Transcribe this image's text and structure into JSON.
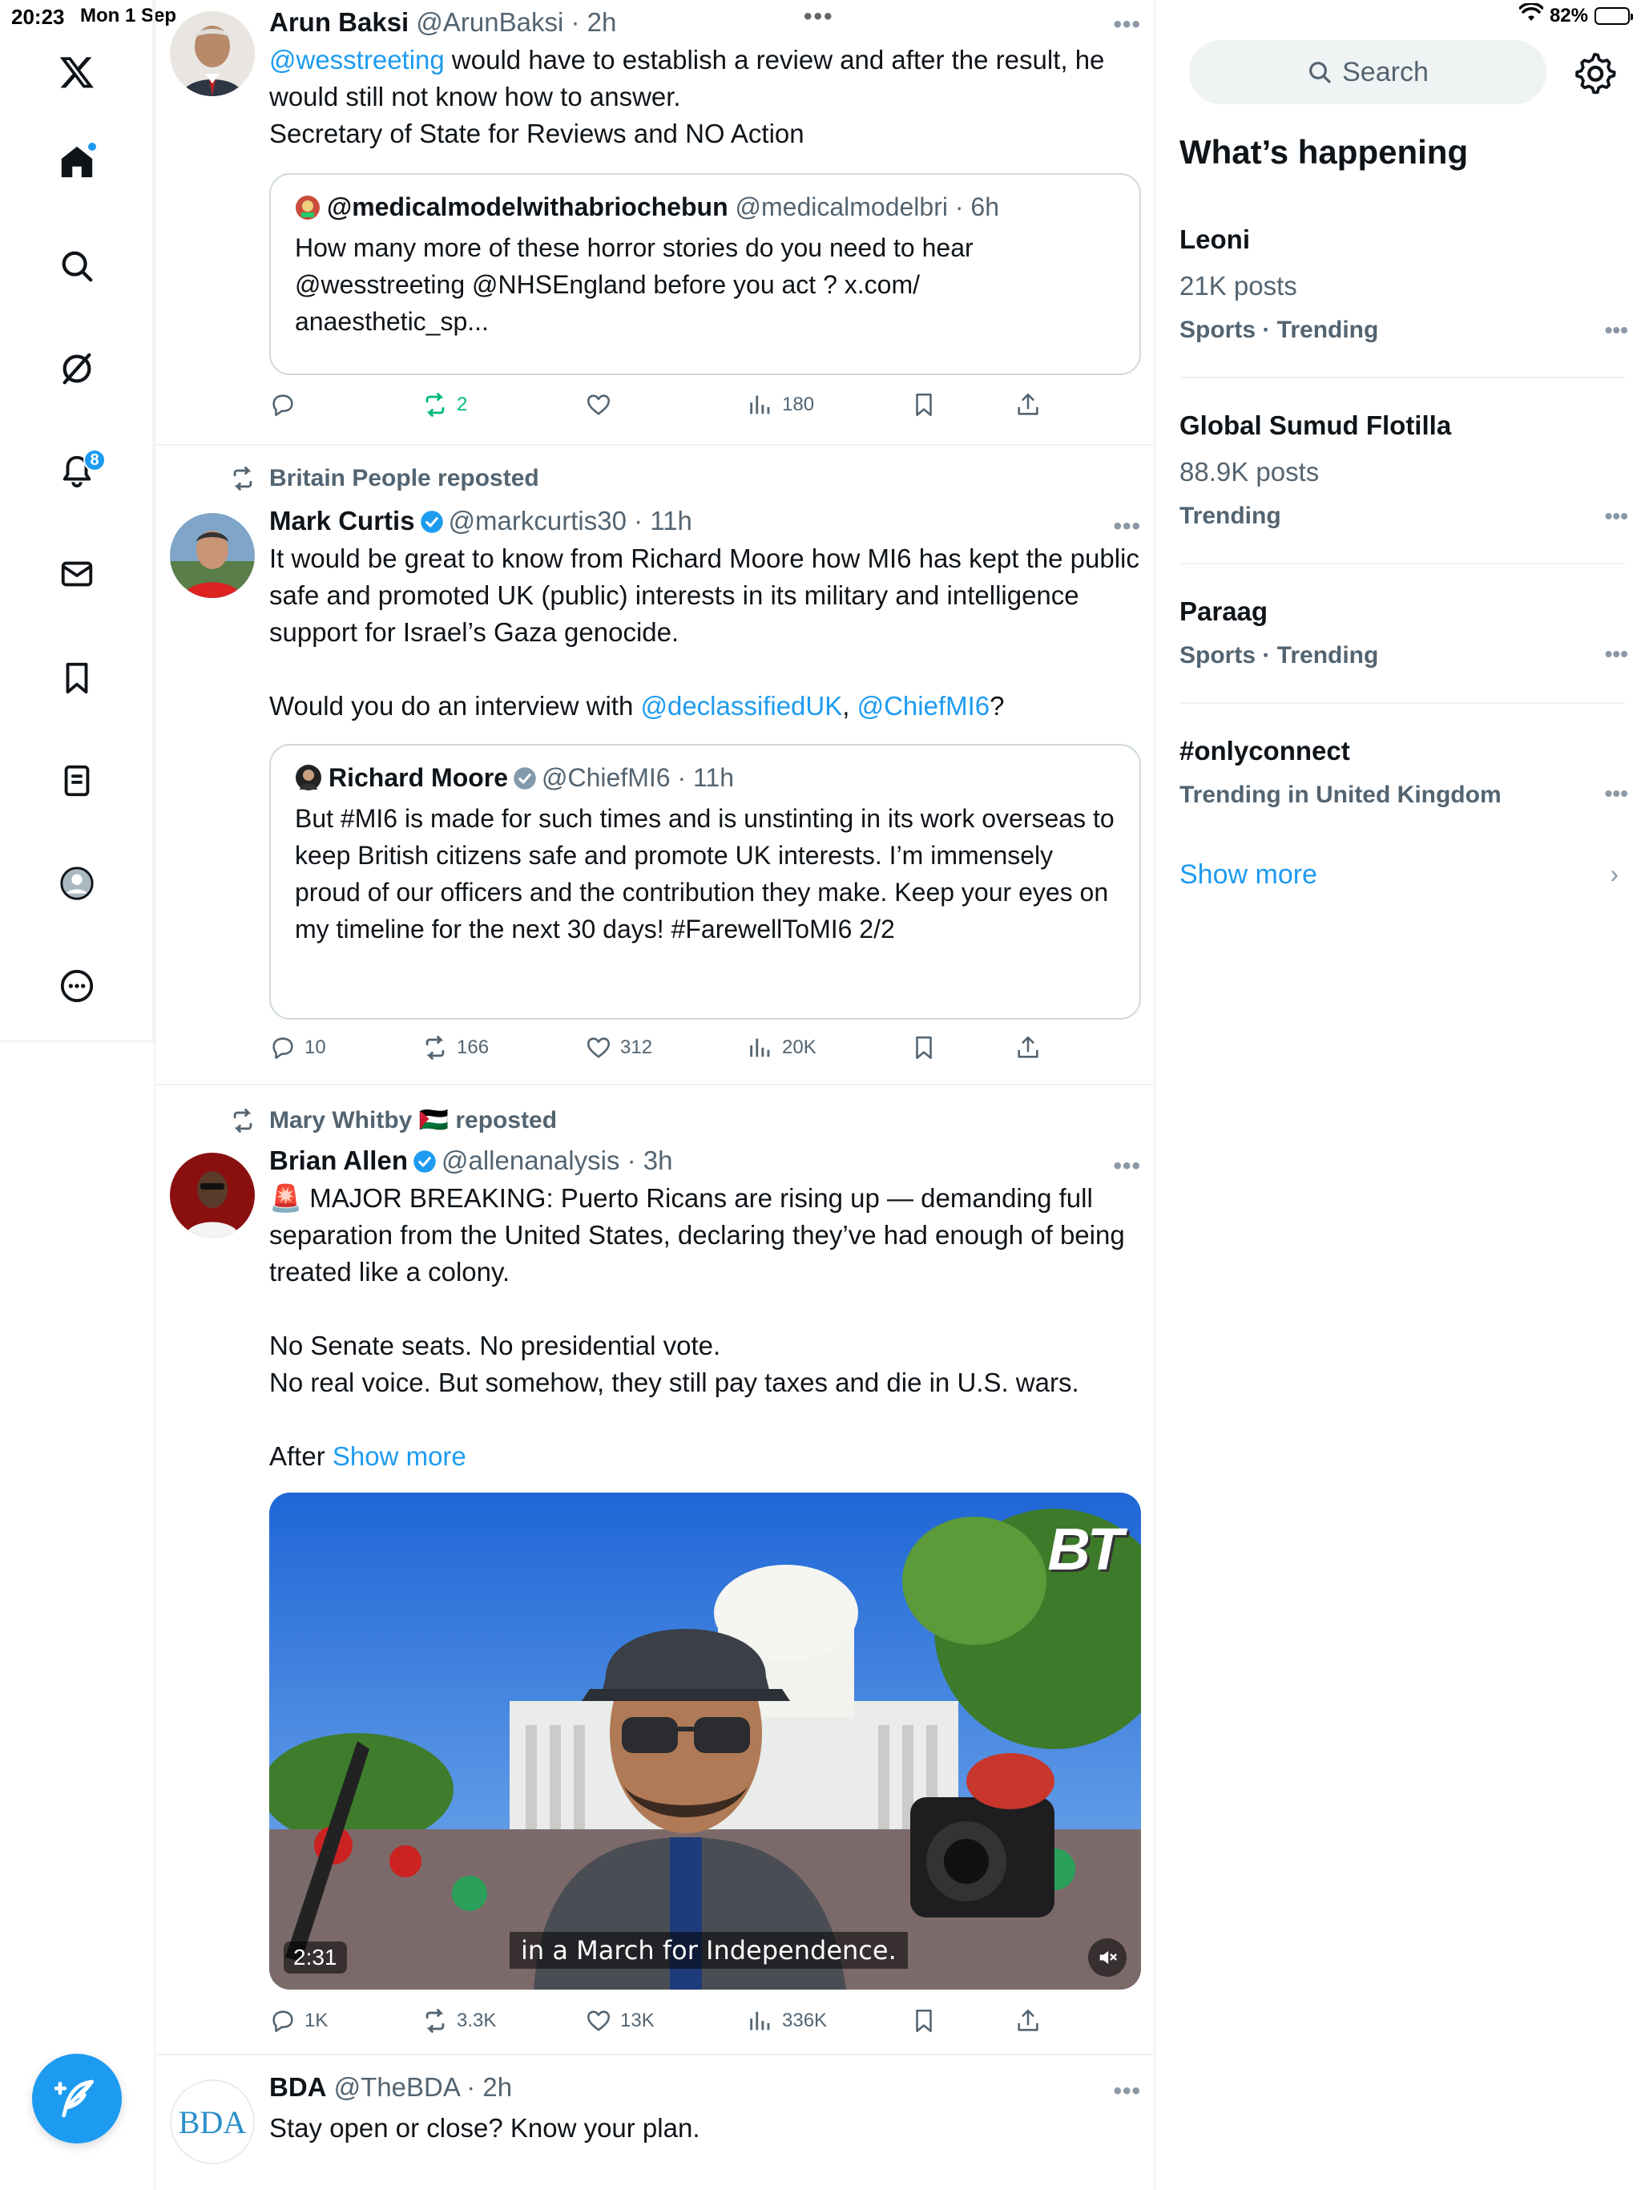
{
  "status": {
    "time": "20:23",
    "date": "Mon 1 Sep",
    "battery": "82%",
    "battery_level": 0.82
  },
  "nav": {
    "notifications_badge": "8"
  },
  "posts": [
    {
      "name": "Arun Baksi",
      "handle": "@ArunBaksi",
      "time": "2h",
      "text_mention": "@wesstreeting",
      "text_rest": " would have to establish a review and after the result, he would still not know how to answer.\nSecretary of State for Reviews and NO Action",
      "quote": {
        "name": "@medicalmodelwithabriochebun",
        "handle": "@medicalmodelbri",
        "time": "6h",
        "text": "How many more of these horror stories do you need to hear @wesstreeting @NHSEngland before you act ? x.com/\nanaesthetic_sp..."
      },
      "reply_count": "",
      "repost_count": "2",
      "like_count": "",
      "view_count": "180"
    },
    {
      "reposted_by": "Britain People reposted",
      "name": "Mark Curtis",
      "handle": "@markcurtis30",
      "time": "11h",
      "text": "It would be great to know from Richard Moore how MI6 has kept the public safe and promoted UK (public) interests in its military and intelligence support for Israel’s Gaza genocide.\n\nWould you do an interview with ",
      "mention1": "@declassifiedUK",
      "sep": ", ",
      "mention2": "@ChiefMI6",
      "tail": "?",
      "quote": {
        "name": "Richard Moore",
        "handle": "@ChiefMI6",
        "time": "11h",
        "text": "But #MI6 is made for such times and is unstinting in its work overseas to keep British citizens safe and promote UK interests. I’m immensely proud of our officers and the contribution they make. Keep your eyes on my timeline for the next 30 days! #FarewellToMI6 2/2"
      },
      "reply_count": "10",
      "repost_count": "166",
      "like_count": "312",
      "view_count": "20K"
    },
    {
      "reposted_by": "Mary Whitby 🇵🇸 reposted",
      "name": "Brian Allen",
      "handle": "@allenanalysis",
      "time": "3h",
      "text": "🚨 MAJOR BREAKING: Puerto Ricans are rising up — demanding full separation from the United States, declaring they’ve had enough of being treated like a colony.\n\nNo Senate seats. No presidential vote.\nNo real voice. But somehow, they still pay taxes and die in U.S. wars.\n\nAfter ",
      "show_more": "Show more",
      "video": {
        "duration": "2:31",
        "caption": "in a March for Independence.",
        "watermark": "BT"
      },
      "reply_count": "1K",
      "repost_count": "3.3K",
      "like_count": "13K",
      "view_count": "336K"
    },
    {
      "name": "BDA",
      "handle": "@TheBDA",
      "time": "2h",
      "text": "Stay open or close? Know your plan.",
      "avatar_text": "BDA"
    }
  ],
  "sidebar_right": {
    "search_placeholder": "Search",
    "title": "What’s happening",
    "trends": [
      {
        "name": "Leoni",
        "posts": "21K posts",
        "meta": "Sports · Trending"
      },
      {
        "name": "Global Sumud Flotilla",
        "posts": "88.9K posts",
        "meta": "Trending"
      },
      {
        "name": "Paraag",
        "posts": "",
        "meta": "Sports · Trending"
      },
      {
        "name": "#onlyconnect",
        "posts": "",
        "meta": "Trending in United Kingdom"
      }
    ],
    "show_more": "Show more"
  },
  "colors": {
    "accent": "#1d9bf0",
    "repost_green": "#00ba7c",
    "muted": "#536471"
  }
}
